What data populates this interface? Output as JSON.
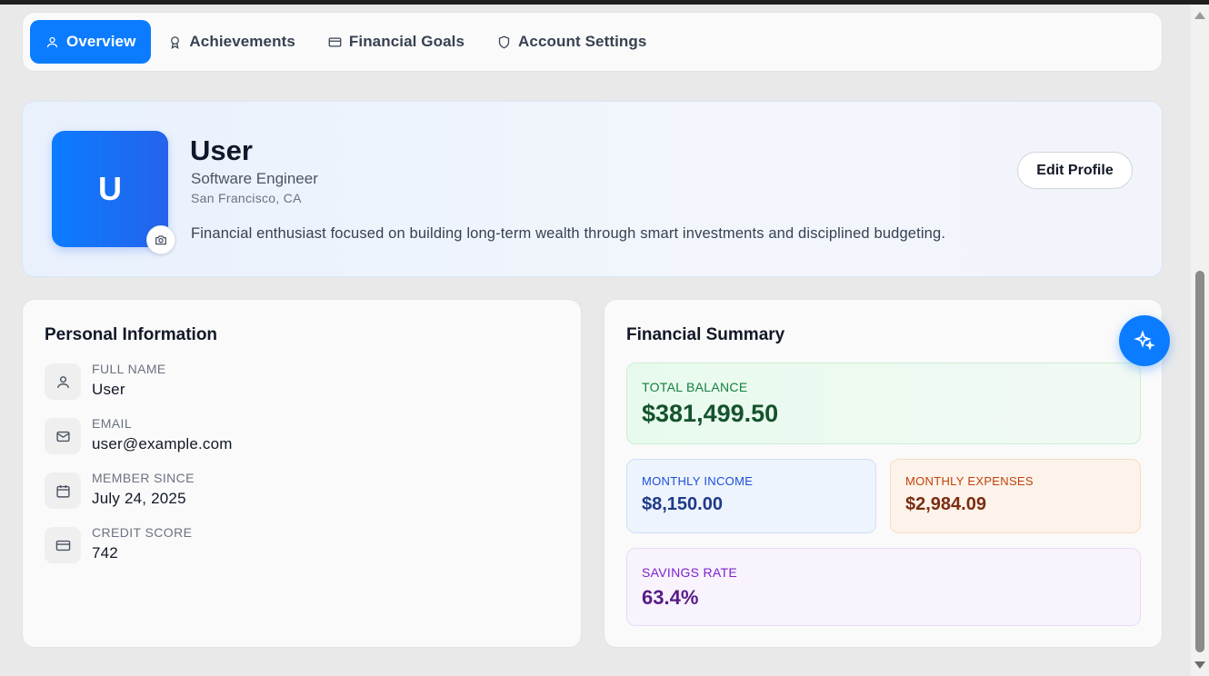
{
  "tabs": [
    {
      "label": "Overview",
      "icon": "user-icon",
      "active": true
    },
    {
      "label": "Achievements",
      "icon": "award-icon",
      "active": false
    },
    {
      "label": "Financial Goals",
      "icon": "credit-card-icon",
      "active": false
    },
    {
      "label": "Account Settings",
      "icon": "shield-icon",
      "active": false
    }
  ],
  "profile": {
    "initial": "U",
    "name": "User",
    "role": "Software Engineer",
    "location": "San Francisco, CA",
    "bio": "Financial enthusiast focused on building long-term wealth through smart investments and disciplined budgeting.",
    "edit_label": "Edit Profile"
  },
  "personal": {
    "title": "Personal Information",
    "rows": [
      {
        "label": "FULL NAME",
        "value": "User",
        "icon": "user-icon"
      },
      {
        "label": "EMAIL",
        "value": "user@example.com",
        "icon": "mail-icon"
      },
      {
        "label": "MEMBER SINCE",
        "value": "July 24, 2025",
        "icon": "calendar-icon"
      },
      {
        "label": "CREDIT SCORE",
        "value": "742",
        "icon": "credit-card-icon"
      }
    ]
  },
  "financial": {
    "title": "Financial Summary",
    "total_balance": {
      "label": "TOTAL BALANCE",
      "value": "$381,499.50"
    },
    "monthly_income": {
      "label": "MONTHLY INCOME",
      "value": "$8,150.00"
    },
    "monthly_expenses": {
      "label": "MONTHLY EXPENSES",
      "value": "$2,984.09"
    },
    "savings_rate": {
      "label": "SAVINGS RATE",
      "value": "63.4%"
    }
  },
  "colors": {
    "accent": "#0b7cff",
    "income": "#1e3a8a",
    "expenses": "#7c2d12",
    "savings": "#581c87",
    "balance": "#14532d"
  }
}
